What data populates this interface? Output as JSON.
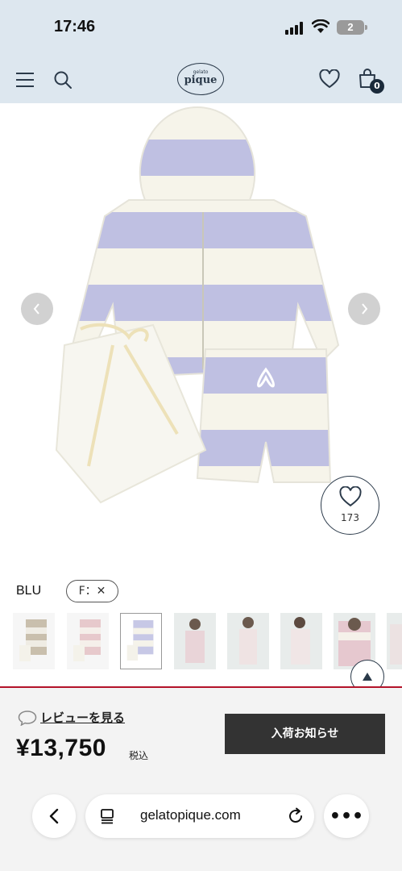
{
  "status_bar": {
    "time": "17:46",
    "battery": "2"
  },
  "header": {
    "logo_small": "gelato",
    "logo_main": "pique",
    "cart_count": "0"
  },
  "product": {
    "like_count": "173",
    "color": "BLU",
    "size_chip": "F：✕",
    "thumbnails": [
      "thumb-brown",
      "thumb-pink",
      "thumb-blue",
      "thumb-model-1",
      "thumb-model-2",
      "thumb-model-3",
      "thumb-model-4",
      "thumb-model-5"
    ]
  },
  "purchase": {
    "review_link": "レビューを見る",
    "price": "¥13,750",
    "tax_label": "税込",
    "notify_button": "入荷お知らせ"
  },
  "browser": {
    "url": "gelatopique.com",
    "more": "•••"
  },
  "colors": {
    "header_bg": "#dde7ef",
    "accent_line": "#b3132a",
    "button_dark": "#333333",
    "navy": "#2b3a4a"
  },
  "icons": [
    "hamburger-icon",
    "search-icon",
    "heart-icon",
    "bag-icon",
    "chevron-left-icon",
    "chevron-right-icon",
    "chevron-up-icon",
    "speech-bubble-icon",
    "tabs-icon",
    "reload-icon",
    "back-icon",
    "more-icon"
  ]
}
